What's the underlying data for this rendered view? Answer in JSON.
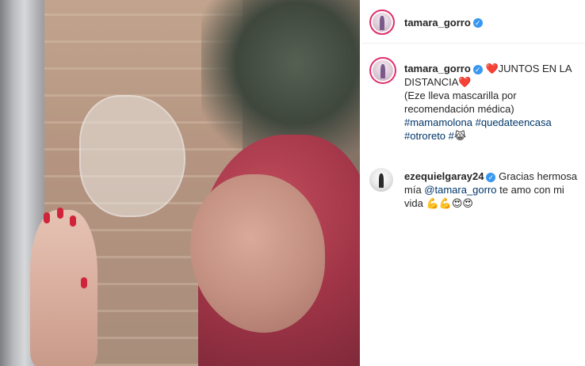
{
  "post": {
    "author": "tamara_gorro",
    "verified_glyph": "✓"
  },
  "caption": {
    "username": "tamara_gorro",
    "heart1": "❤️",
    "title": "JUNTOS EN LA DISTANCIA",
    "heart2": "❤️",
    "note": "(Eze lleva mascarilla por recomendación médica)",
    "hashtags": [
      "#mamamolona",
      "#quedateencasa",
      "#otroreto",
      "#"
    ],
    "tail_emoji": "😹"
  },
  "comment": {
    "username": "ezequielgaray24",
    "text_before": "Gracias hermosa mía ",
    "mention": "@tamara_gorro",
    "text_after": " te amo con mi vida ",
    "emojis": "💪💪😍😍"
  },
  "colors": {
    "accent_link": "#003569",
    "verified_blue": "#3897f0",
    "nail_red": "#d0243a"
  },
  "icons": {
    "verified": "verified-badge-icon"
  }
}
